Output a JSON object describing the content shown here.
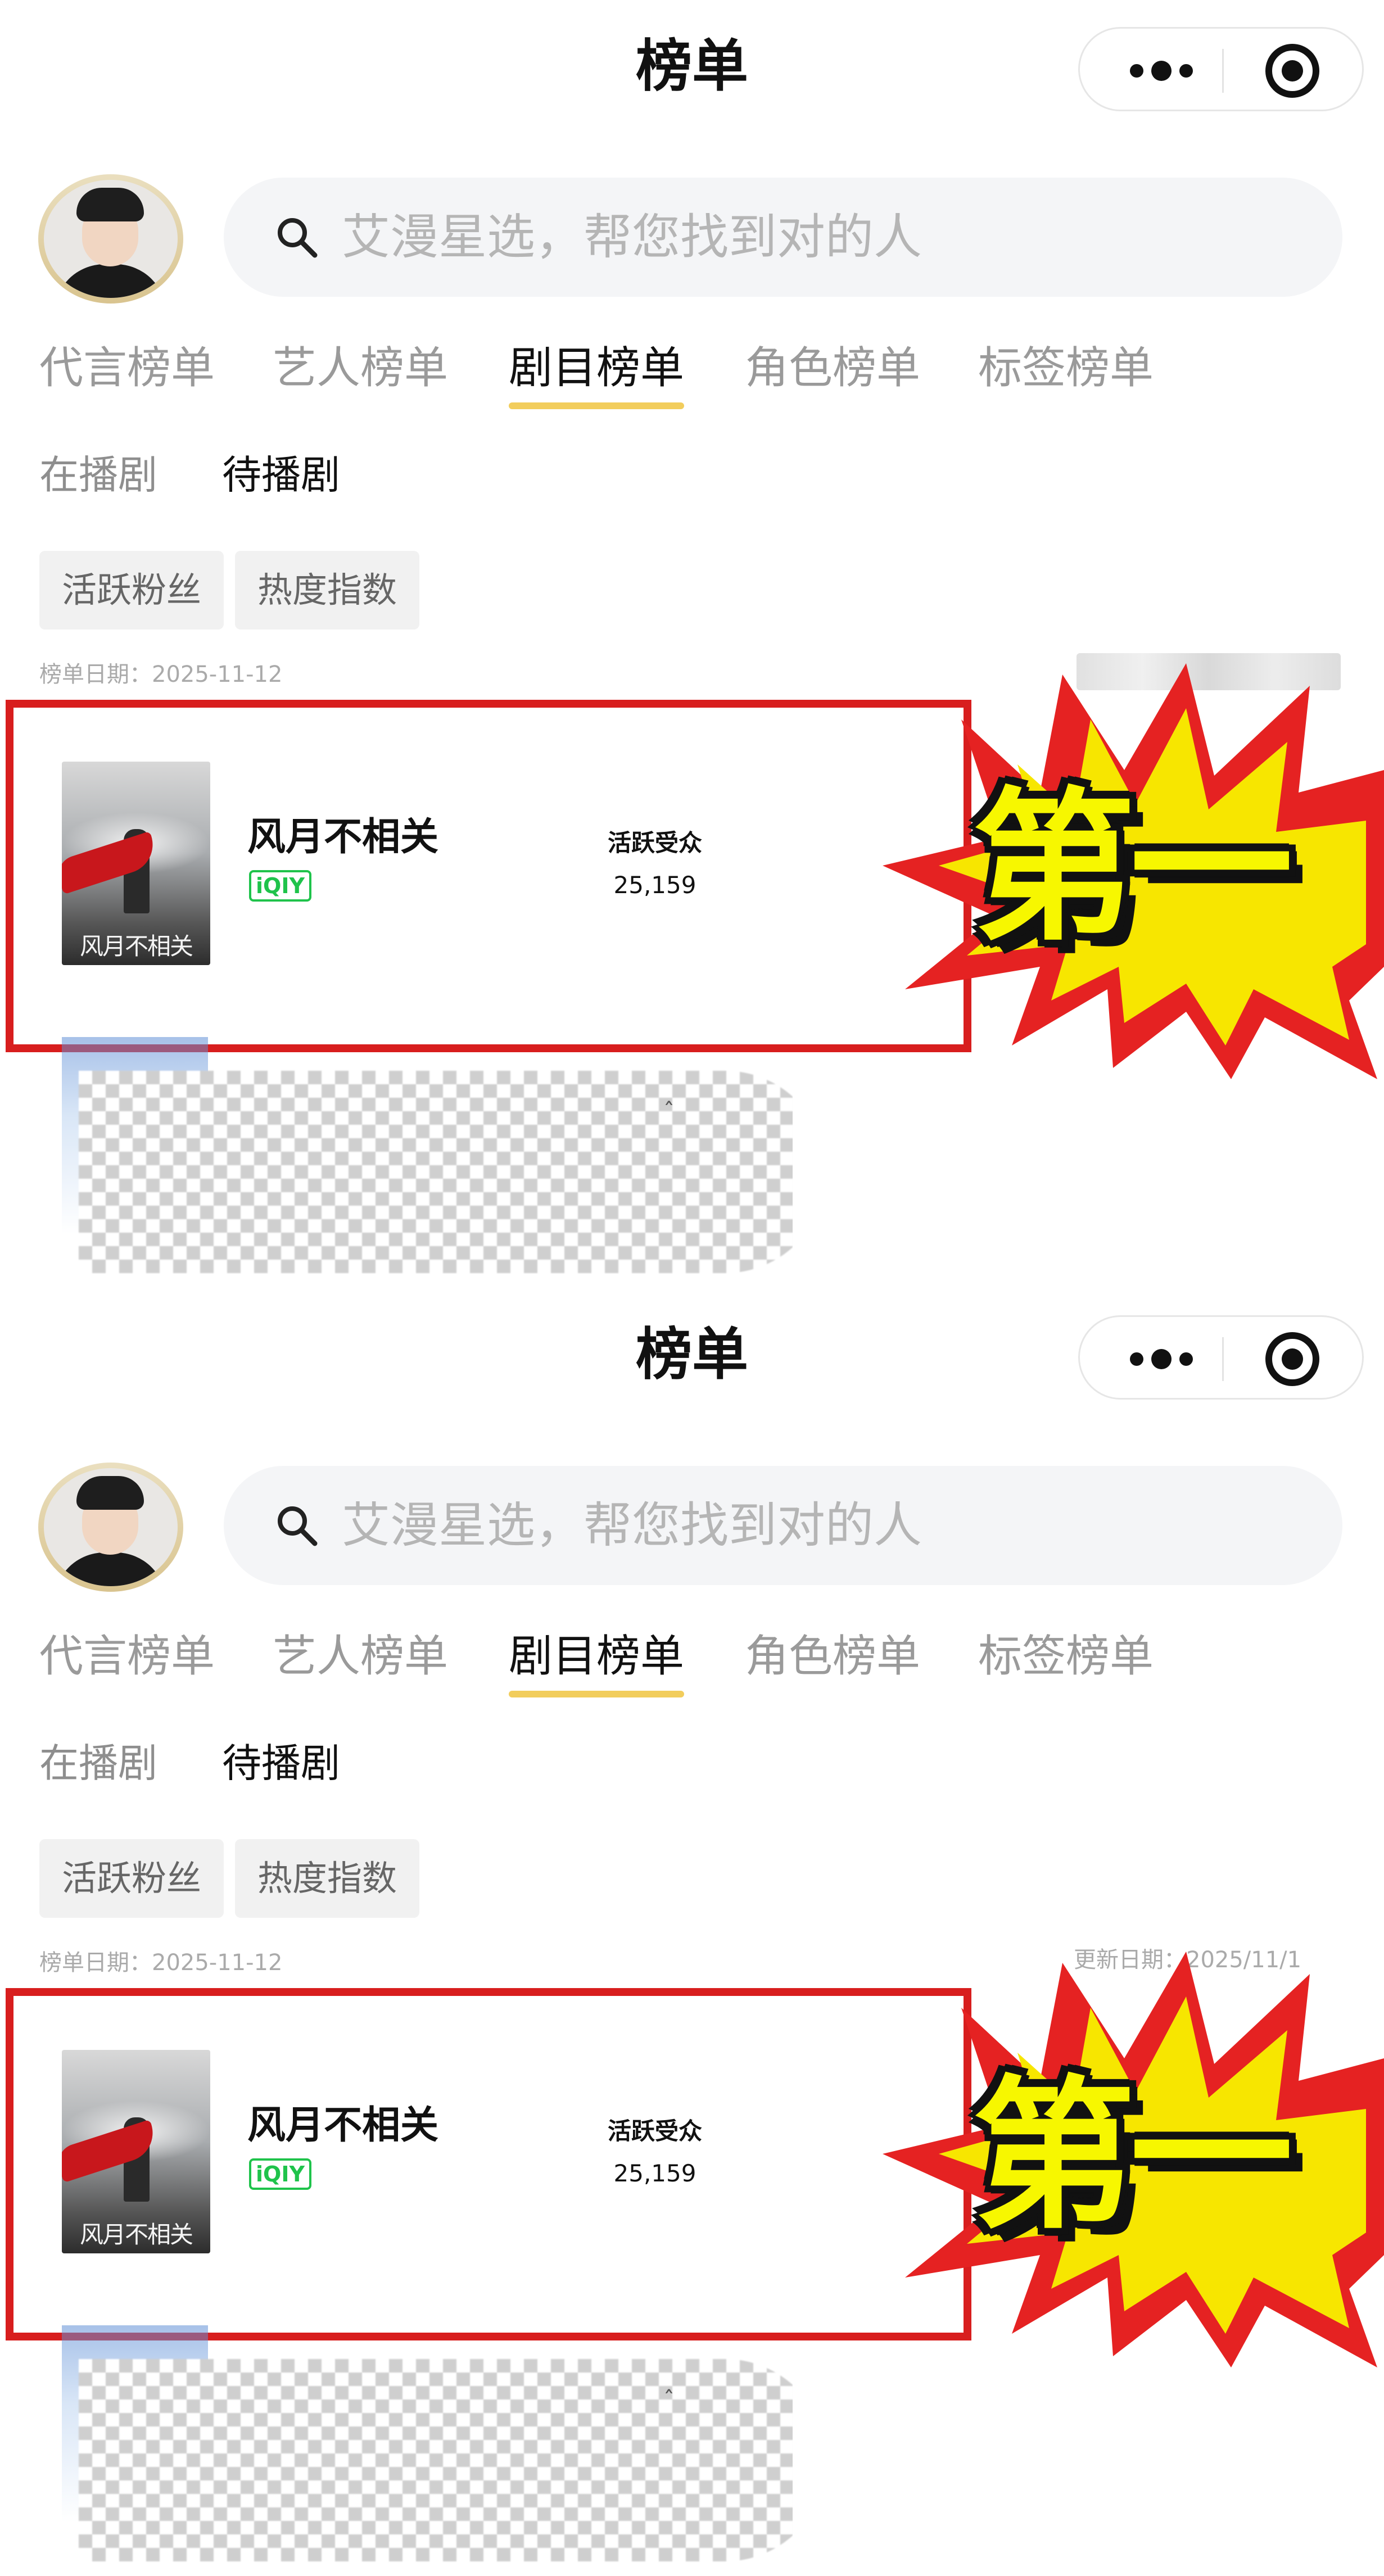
{
  "panels": [
    {
      "header": {
        "title": "榜单"
      },
      "capsule": {
        "more_icon": "more-dots-icon",
        "target_icon": "target-icon"
      },
      "search": {
        "placeholder": "艾漫星选，帮您找到对的人",
        "icon": "search-icon"
      },
      "tabs": [
        {
          "label": "代言榜单",
          "active": false
        },
        {
          "label": "艺人榜单",
          "active": false
        },
        {
          "label": "剧目榜单",
          "active": true
        },
        {
          "label": "角色榜单",
          "active": false
        },
        {
          "label": "标签榜单",
          "active": false
        }
      ],
      "subtabs": [
        {
          "label": "在播剧",
          "active": false
        },
        {
          "label": "待播剧",
          "active": true
        }
      ],
      "chips": [
        {
          "label": "活跃粉丝"
        },
        {
          "label": "热度指数"
        }
      ],
      "list_date": "榜单日期：2025-11-12",
      "update_date": "",
      "entry": {
        "title": "风月不相关",
        "platform": "iQIY",
        "poster_title": "风月不相关",
        "metric_label": "活跃受众",
        "metric_value": "25,159"
      },
      "badge": "第一"
    },
    {
      "header": {
        "title": "榜单"
      },
      "capsule": {
        "more_icon": "more-dots-icon",
        "target_icon": "target-icon"
      },
      "search": {
        "placeholder": "艾漫星选，帮您找到对的人",
        "icon": "search-icon"
      },
      "tabs": [
        {
          "label": "代言榜单",
          "active": false
        },
        {
          "label": "艺人榜单",
          "active": false
        },
        {
          "label": "剧目榜单",
          "active": true
        },
        {
          "label": "角色榜单",
          "active": false
        },
        {
          "label": "标签榜单",
          "active": false
        }
      ],
      "subtabs": [
        {
          "label": "在播剧",
          "active": false
        },
        {
          "label": "待播剧",
          "active": true
        }
      ],
      "chips": [
        {
          "label": "活跃粉丝"
        },
        {
          "label": "热度指数"
        }
      ],
      "list_date": "榜单日期：2025-11-12",
      "update_date": "更新日期：2025/11/1",
      "entry": {
        "title": "风月不相关",
        "platform": "iQIY",
        "poster_title": "风月不相关",
        "metric_label": "活跃受众",
        "metric_value": "25,159"
      },
      "badge": "第一"
    }
  ],
  "colors": {
    "accent_underline": "#f2cd5c",
    "highlight_box": "#d81e1e",
    "platform_green": "#1fc34b",
    "burst_red": "#e52222",
    "burst_yellow": "#f7e600"
  }
}
